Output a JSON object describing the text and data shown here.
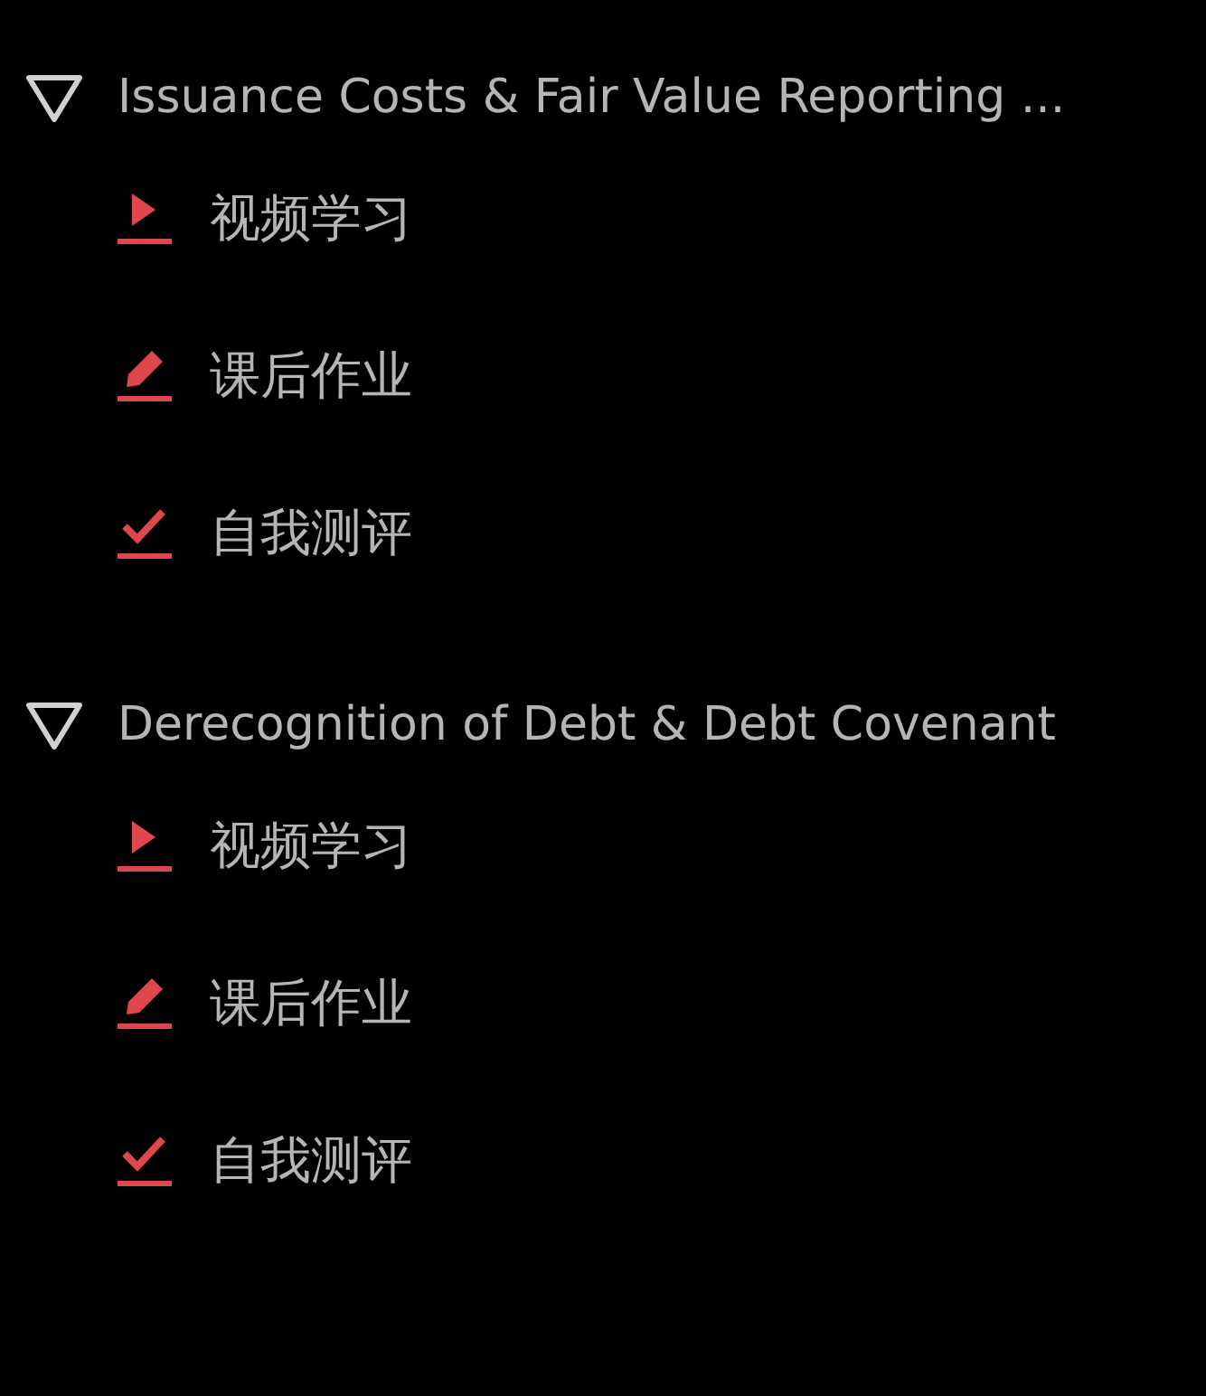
{
  "sections": [
    {
      "title": "Issuance Costs & Fair Value Reporting ...",
      "expanded": true,
      "items": [
        {
          "kind": "video",
          "label": "视频学习"
        },
        {
          "kind": "homework",
          "label": "课后作业"
        },
        {
          "kind": "test",
          "label": "自我测评"
        }
      ]
    },
    {
      "title": "Derecognition of Debt & Debt Covenant",
      "expanded": true,
      "items": [
        {
          "kind": "video",
          "label": "视频学习"
        },
        {
          "kind": "homework",
          "label": "课后作业"
        },
        {
          "kind": "test",
          "label": "自我测评"
        }
      ]
    }
  ]
}
